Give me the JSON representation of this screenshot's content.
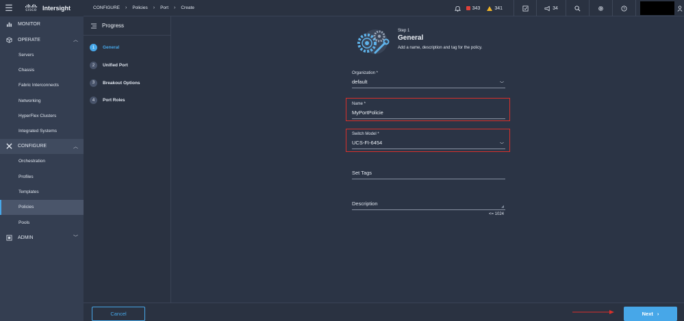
{
  "app": {
    "brand_word": "cisco",
    "product": "Intersight"
  },
  "breadcrumb": [
    "CONFIGURE",
    "Policies",
    "Port",
    "Create"
  ],
  "topbar": {
    "critical_alarms": "343",
    "warning_alarms": "341",
    "announcements": "34"
  },
  "nav": {
    "monitor": "MONITOR",
    "operate": "OPERATE",
    "operate_items": [
      "Servers",
      "Chassis",
      "Fabric Interconnects",
      "Networking",
      "HyperFlex Clusters",
      "Integrated Systems"
    ],
    "configure": "CONFIGURE",
    "configure_items": [
      "Orchestration",
      "Profiles",
      "Templates",
      "Policies",
      "Pools"
    ],
    "admin": "ADMIN",
    "selected_item": "Policies"
  },
  "progress": {
    "title": "Progress",
    "steps": [
      {
        "num": "1",
        "label": "General"
      },
      {
        "num": "2",
        "label": "Unified Port"
      },
      {
        "num": "3",
        "label": "Breakout Options"
      },
      {
        "num": "4",
        "label": "Port Roles"
      }
    ],
    "current_step": "1"
  },
  "form": {
    "step_small": "Step 1",
    "step_title": "General",
    "step_desc": "Add a name, description and tag for the policy.",
    "organization": {
      "label": "Organization *",
      "value": "default"
    },
    "name": {
      "label": "Name *",
      "value": "MyPortPolicie"
    },
    "switch_model": {
      "label": "Switch Model *",
      "value": "UCS-FI-6454"
    },
    "tags": {
      "label": "Set Tags"
    },
    "description": {
      "label": "Description",
      "counter": "<= 1024"
    }
  },
  "footer": {
    "cancel": "Cancel",
    "next": "Next"
  },
  "colors": {
    "accent": "#47a7e8",
    "highlight": "#d9302b",
    "background": "#2b3445"
  }
}
